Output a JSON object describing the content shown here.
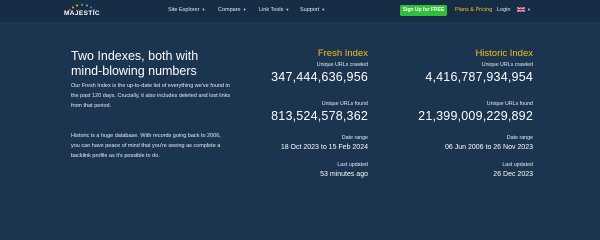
{
  "nav": {
    "logo_text": "MAJESTIC",
    "items": [
      {
        "label": "Site Explorer"
      },
      {
        "label": "Compare"
      },
      {
        "label": "Link Tools"
      },
      {
        "label": "Support"
      }
    ],
    "signup_label": "Sign Up for FREE",
    "plans_label": "Plans & Pricing",
    "login_label": "Login",
    "colors": {
      "accent_green": "#2fbf3a",
      "accent_yellow": "#f5c518",
      "background": "#1b3450"
    }
  },
  "intro": {
    "heading_line1": "Two Indexes, both with",
    "heading_line2": "mind-blowing numbers",
    "para1": "Our Fresh Index is the up-to-date list of everything we've found in the past 120 days. Crucially, it also includes deleted and lost links from that period.",
    "para2": "Historic is a huge database. With records going back to 2006, you can have peace of mind that you're seeing as complete a backlink profile as it's possible to do."
  },
  "fresh": {
    "title": "Fresh Index",
    "crawled_label": "Unique URLs crawled",
    "crawled_value": "347,444,636,956",
    "found_label": "Unique URLs found",
    "found_value": "813,524,578,362",
    "range_label": "Date range",
    "range_value": "18 Oct 2023 to 15 Feb 2024",
    "updated_label": "Last updated",
    "updated_value": "53 minutes ago"
  },
  "historic": {
    "title": "Historic Index",
    "crawled_label": "Unique URLs crawled",
    "crawled_value": "4,416,787,934,954",
    "found_label": "Unique URLs found",
    "found_value": "21,399,009,229,892",
    "range_label": "Date range",
    "range_value": "06 Jun 2006 to 26 Nov 2023",
    "updated_label": "Last updated",
    "updated_value": "26 Dec 2023"
  }
}
